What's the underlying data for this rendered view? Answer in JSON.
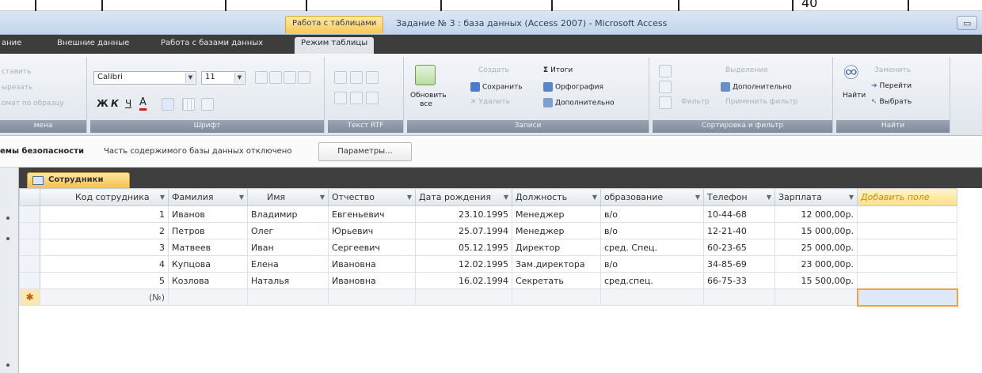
{
  "top_fragment": {
    "text": "40"
  },
  "window": {
    "context_tab": "Работа с таблицами",
    "title": "Задание № 3 : база данных (Access 2007) - Microsoft Access",
    "control_glyph": "▭"
  },
  "ribbon_tabs": [
    {
      "label": "ание"
    },
    {
      "label": "Внешние данные"
    },
    {
      "label": "Работа с базами данных"
    },
    {
      "label": "Режим таблицы"
    }
  ],
  "ribbon": {
    "clipboard": {
      "items": [
        "ставить",
        "ырезать",
        "омат по образцу"
      ],
      "label": "мена"
    },
    "font": {
      "font_name": "Calibri",
      "font_size": "11",
      "format_buttons": [
        "Ж",
        "К",
        "Ч",
        "А"
      ],
      "label": "Шрифт"
    },
    "rtf": {
      "label": "Текст RTF"
    },
    "records": {
      "refresh_label": "Обновить все",
      "create_label": "Создать",
      "save_label": "Сохранить",
      "delete_label": "Удалить",
      "totals_label": "Итоги",
      "spelling_label": "Орфография",
      "more_label": "Дополнительно",
      "label": "Записи"
    },
    "sort_filter": {
      "filter_label": "Фильтр",
      "selection_label": "Выделение",
      "advanced_label": "Дополнительно",
      "apply_label": "Применить фильтр",
      "label": "Сортировка и фильтр"
    },
    "find": {
      "find_label": "Найти",
      "replace_label": "Заменить",
      "goto_label": "Перейти",
      "select_label": "Выбрать",
      "label": "Найти"
    }
  },
  "security_bar": {
    "title": "емы безопасности",
    "message": "Часть содержимого базы данных отключено",
    "button": "Параметры..."
  },
  "object_tab": {
    "label": "Сотрудники"
  },
  "datasheet": {
    "columns": [
      "Код сотрудника",
      "Фамилия",
      "Имя",
      "Отчество",
      "Дата рождения",
      "Должность",
      "образование",
      "Телефон",
      "Зарплата"
    ],
    "add_field": "Добавить поле",
    "rows": [
      [
        "1",
        "Иванов",
        "Владимир",
        "Евгеньевич",
        "23.10.1995",
        "Менеджер",
        "в/о",
        "10-44-68",
        "12 000,00р."
      ],
      [
        "2",
        "Петров",
        "Олег",
        "Юрьевич",
        "25.07.1994",
        "Менеджер",
        "в/о",
        "12-21-40",
        "15 000,00р."
      ],
      [
        "3",
        "Матвеев",
        "Иван",
        "Сергеевич",
        "05.12.1995",
        "Директор",
        "сред. Спец.",
        "60-23-65",
        "25 000,00р."
      ],
      [
        "4",
        "Купцова",
        "Елена",
        "Ивановна",
        "12.02.1995",
        "Зам.директора",
        "в/о",
        "34-85-69",
        "23 000,00р."
      ],
      [
        "5",
        "Козлова",
        "Наталья",
        "Ивановна",
        "16.02.1994",
        "Секретать",
        "сред.спец.",
        "66-75-33",
        "15 500,00р."
      ]
    ],
    "new_row": {
      "marker": "✱",
      "placeholder": "(№)"
    }
  },
  "colors": {
    "context_tab": "#f7c95b",
    "tab_row": "#3d3d3d",
    "add_field_text": "#d18a00",
    "new_row_focus": "#f0a33a"
  }
}
